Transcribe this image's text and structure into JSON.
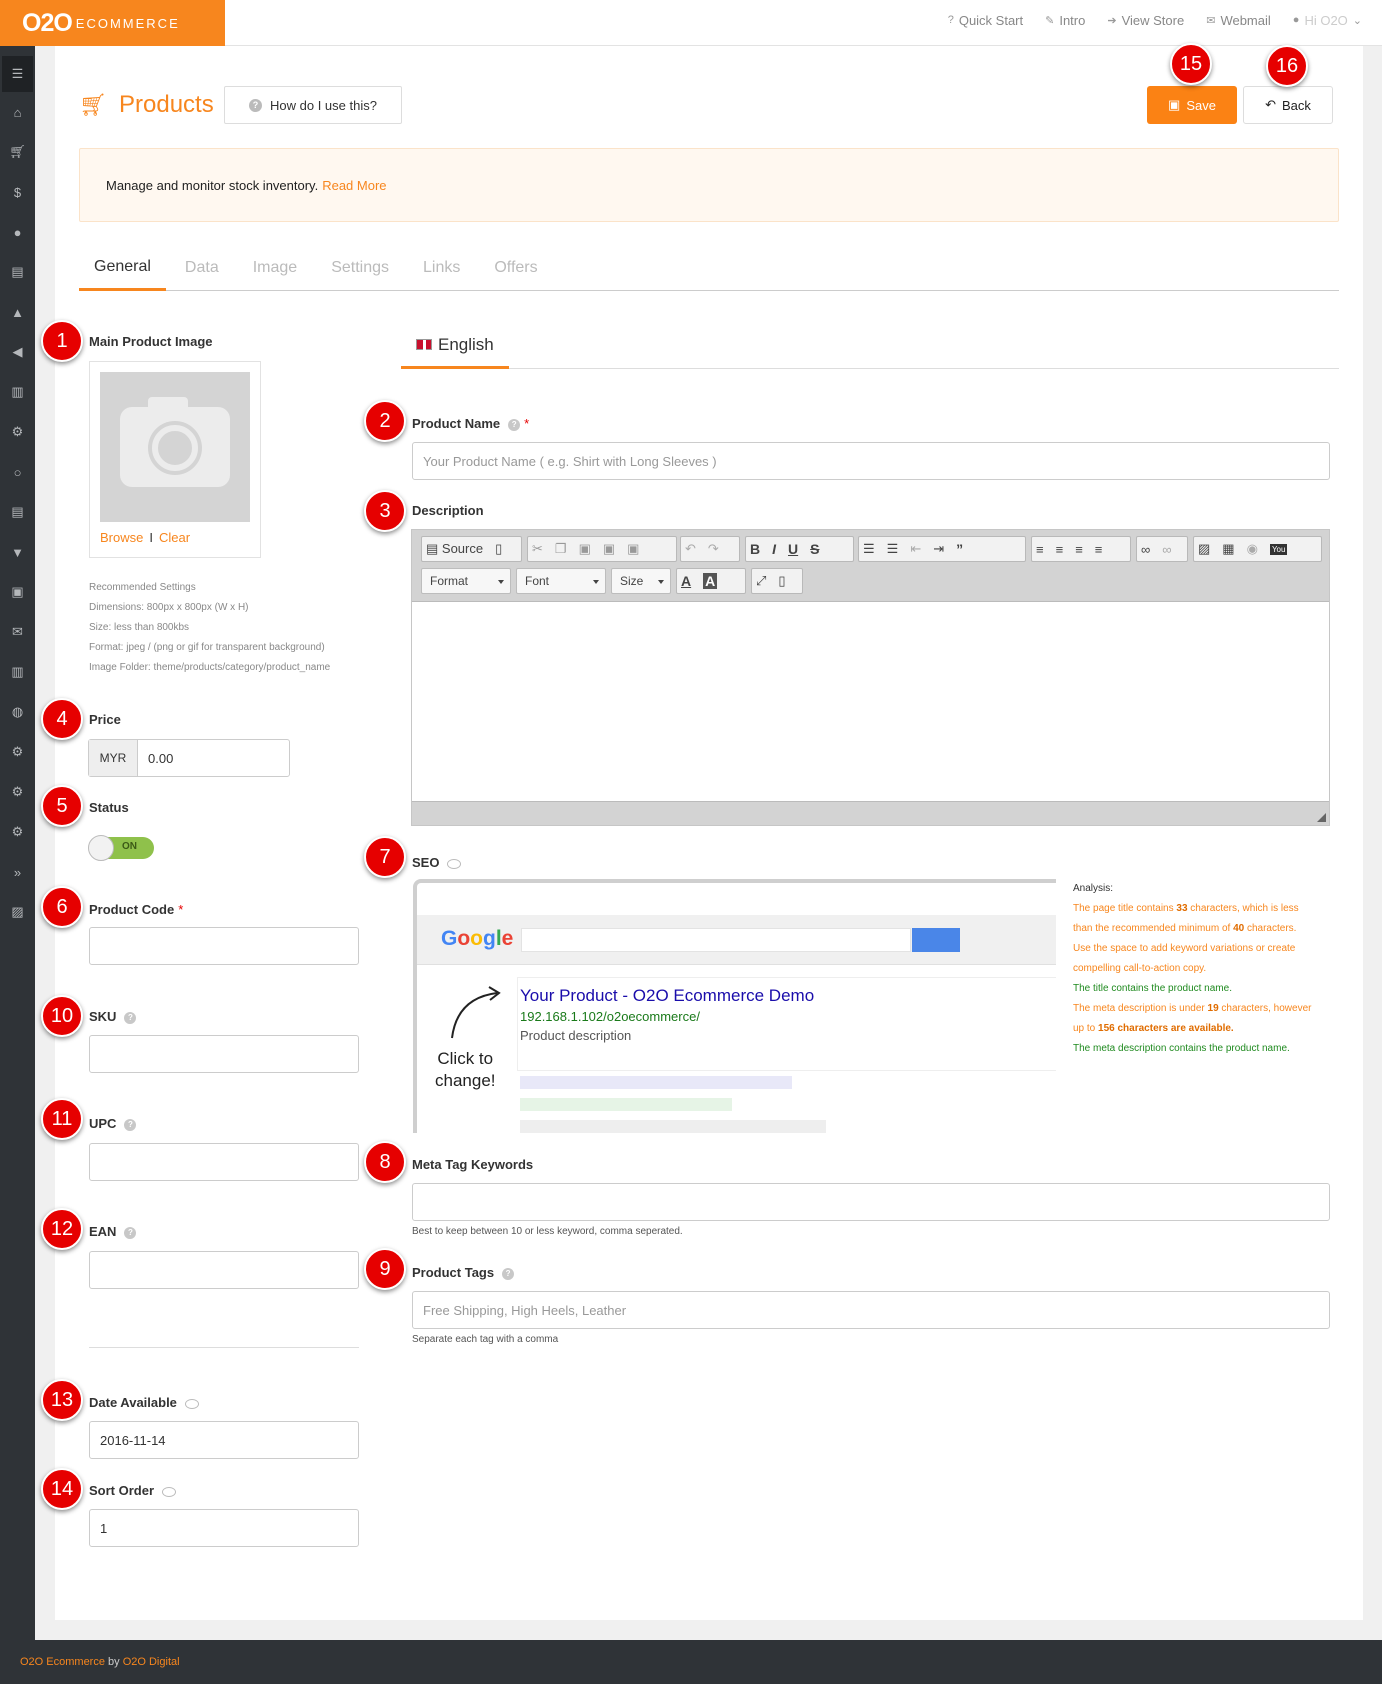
{
  "topbar": {
    "logo_main": "O2O",
    "logo_sub": "ECOMMERCE",
    "nav": [
      {
        "icon": "question-icon",
        "label": "Quick Start"
      },
      {
        "icon": "wand-icon",
        "label": "Intro"
      },
      {
        "icon": "signin-icon",
        "label": "View Store"
      },
      {
        "icon": "envelope-icon",
        "label": "Webmail"
      },
      {
        "icon": "user-icon",
        "label": "Hi O2O"
      }
    ]
  },
  "sidebar": {
    "items": [
      "menu-icon",
      "home-icon",
      "cart-icon",
      "dollar-icon",
      "user-icon",
      "book-icon",
      "thumbs-up-icon",
      "megaphone-icon",
      "chart-icon",
      "cogs-icon",
      "comment-icon",
      "book2-icon",
      "cart2-icon",
      "money-icon",
      "envelope-icon",
      "bar-chart-icon",
      "globe-icon",
      "cog-icon",
      "cog2-icon",
      "cogs2-icon",
      "forward-icon",
      "image-icon"
    ]
  },
  "header": {
    "title": "Products",
    "howto": "How do I use this?",
    "save": "Save",
    "back": "Back"
  },
  "alert": {
    "text": "Manage and monitor stock inventory.",
    "link": "Read More"
  },
  "tabs": [
    "General",
    "Data",
    "Image",
    "Settings",
    "Links",
    "Offers"
  ],
  "left": {
    "main_image_label": "Main Product Image",
    "browse": "Browse",
    "clear": "Clear",
    "recommended": [
      "Recommended Settings",
      "Dimensions: 800px x 800px (W x H)",
      "Size: less than 800kbs",
      "Format: jpeg / (png or gif for transparent background)",
      "Image Folder: theme/products/category/product_name"
    ],
    "price_label": "Price",
    "currency": "MYR",
    "price_value": "0.00",
    "status_label": "Status",
    "status_value": "ON",
    "product_code_label": "Product Code",
    "sku_label": "SKU",
    "upc_label": "UPC",
    "ean_label": "EAN",
    "date_label": "Date Available",
    "date_value": "2016-11-14",
    "sort_label": "Sort Order",
    "sort_value": "1"
  },
  "right": {
    "language": "English",
    "product_name_label": "Product Name",
    "product_name_placeholder": "Your Product Name ( e.g. Shirt with Long Sleeves )",
    "description_label": "Description",
    "editor": {
      "source": "Source",
      "format": "Format",
      "font": "Font",
      "size": "Size"
    },
    "seo_label": "SEO",
    "seo_preview": {
      "title": "Your Product - O2O Ecommerce Demo",
      "url": "192.168.1.102/o2oecommerce/",
      "description": "Product description",
      "click_hint_1": "Click to",
      "click_hint_2": "change!"
    },
    "analysis": {
      "heading": "Analysis:",
      "line1a": "The page title contains ",
      "line1_num": "33",
      "line1b": " characters, which is less than the recommended minimum of ",
      "line1_num2": "40",
      "line1c": " characters. Use the space to add keyword variations or create compelling call-to-action copy.",
      "line2": "The title contains the product name.",
      "line3a": "The meta description is under ",
      "line3_num": "19",
      "line3b": " characters, however up to ",
      "line3_num2": "156 characters are available.",
      "line4": "The meta description contains the product name."
    },
    "meta_keywords_label": "Meta Tag Keywords",
    "meta_keywords_help": "Best to keep between 10 or less keyword, comma seperated.",
    "tags_label": "Product Tags",
    "tags_placeholder": "Free Shipping, High Heels, Leather",
    "tags_help": "Separate each tag with a comma"
  },
  "badges": [
    "1",
    "2",
    "3",
    "4",
    "5",
    "6",
    "7",
    "8",
    "9",
    "10",
    "11",
    "12",
    "13",
    "14",
    "15",
    "16"
  ],
  "footer": {
    "brand": "O2O Ecommerce",
    "by": " by ",
    "company": "O2O Digital"
  },
  "colors": {
    "accent": "#f7861e",
    "sidebar": "#2f3337",
    "badge": "#e60000",
    "toggle_on": "#8fc14b"
  }
}
